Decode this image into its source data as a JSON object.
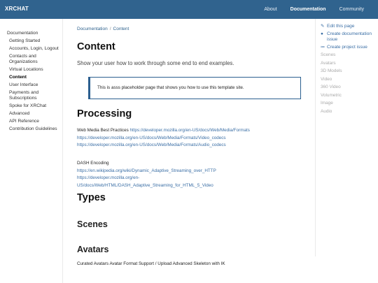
{
  "header": {
    "brand": "XRCHAT",
    "nav": [
      {
        "label": "About"
      },
      {
        "label": "Documentation"
      },
      {
        "label": "Community"
      }
    ]
  },
  "sidebar": {
    "root": "Documentation",
    "items": [
      {
        "label": "Getting Started"
      },
      {
        "label": "Accounts, Login, Logout"
      },
      {
        "label": "Contacts and Organizations"
      },
      {
        "label": "Virtual Locations"
      },
      {
        "label": "Content"
      },
      {
        "label": "User Interface"
      },
      {
        "label": "Payments and Subscriptions"
      },
      {
        "label": "Spoke for XRChat"
      },
      {
        "label": "Advanced"
      },
      {
        "label": "API Reference"
      },
      {
        "label": "Contribution Guidelines"
      }
    ]
  },
  "breadcrumb": {
    "items": [
      "Documentation",
      "Content"
    ],
    "separator": "/"
  },
  "page": {
    "title": "Content",
    "lead": "Show your user how to work through some end to end examples.",
    "callout": "This is asss placeholder page that shows you how to use this template site.",
    "processing_heading": "Processing",
    "web_media_label": "Web Media Best Practices",
    "web_media_links": [
      "https://developer.mozilla.org/en-US/docs/Web/Media/Formats",
      "https://developer.mozilla.org/en-US/docs/Web/Media/Formats/Video_codecs",
      "https://developer.mozilla.org/en-US/docs/Web/Media/Formats/Audio_codecs"
    ],
    "dash_label": "DASH Encoding",
    "dash_links": [
      "https://en.wikipedia.org/wiki/Dynamic_Adaptive_Streaming_over_HTTP",
      "https://developer.mozilla.org/en-US/docs/Web/HTML/DASH_Adaptive_Streaming_for_HTML_5_Video"
    ],
    "types_heading": "Types",
    "scenes_heading": "Scenes",
    "avatars_heading": "Avatars",
    "avatars_text": "Curated Avatars Avatar Format Support / Upload Advanced Skeleton with IK"
  },
  "right_sidebar": {
    "links": [
      {
        "icon": "edit-icon",
        "label": "Edit this page"
      },
      {
        "icon": "github-icon",
        "label": "Create documentation issue"
      },
      {
        "icon": "list-icon",
        "label": "Create project issue"
      }
    ],
    "toc": [
      "Scenes",
      "Avatars",
      "3D Models",
      "Video",
      "360 Video",
      "Volumetric",
      "Image",
      "Audio"
    ]
  },
  "colors": {
    "header_bg": "#30638e",
    "link": "#3a6ea5",
    "callout_border": "#2b5f8f"
  }
}
